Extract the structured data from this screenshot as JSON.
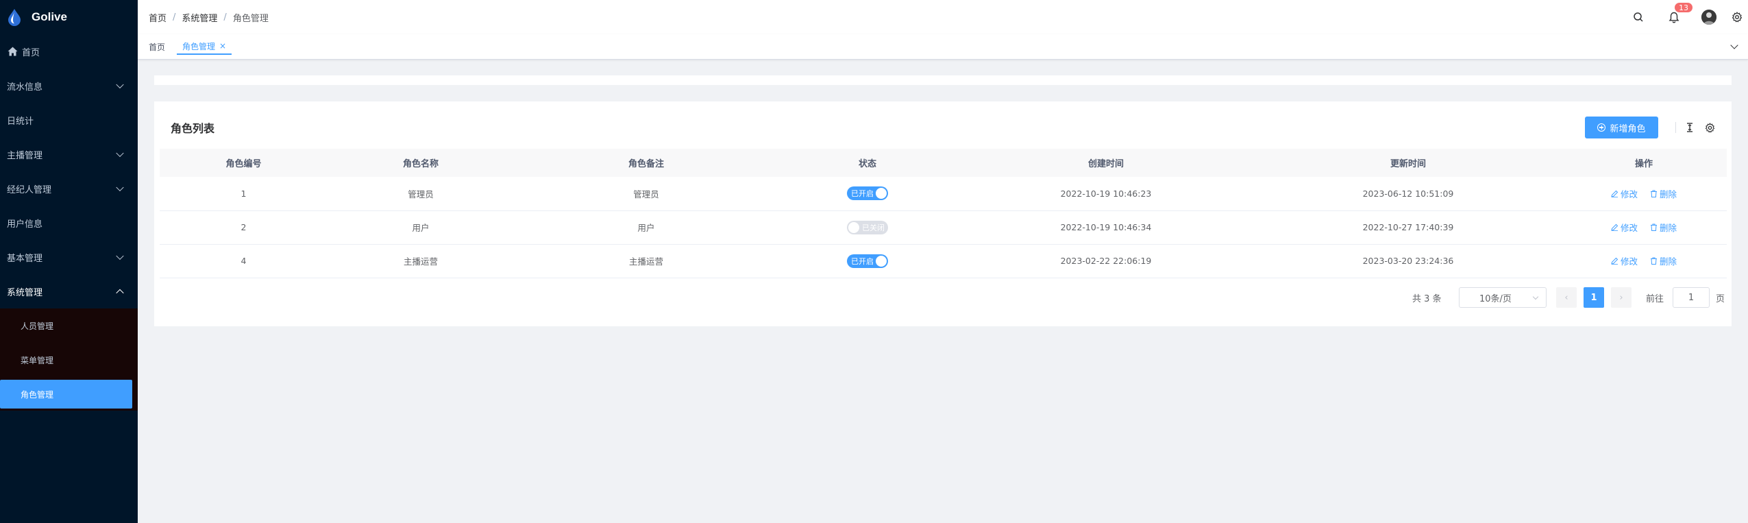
{
  "app": {
    "title": "Golive"
  },
  "sidebar": {
    "items": [
      {
        "label": "首页"
      },
      {
        "label": "流水信息"
      },
      {
        "label": "日统计"
      },
      {
        "label": "主播管理"
      },
      {
        "label": "经纪人管理"
      },
      {
        "label": "用户信息"
      },
      {
        "label": "基本管理"
      },
      {
        "label": "系统管理"
      }
    ],
    "sub_items": [
      {
        "label": "人员管理"
      },
      {
        "label": "菜单管理"
      },
      {
        "label": "角色管理"
      }
    ]
  },
  "header": {
    "breadcrumb": [
      "首页",
      "系统管理",
      "角色管理"
    ],
    "breadcrumb_separator": "/",
    "notification_count": "13"
  },
  "tags": {
    "home": "首页",
    "active": "角色管理",
    "close": "×"
  },
  "card": {
    "title": "角色列表",
    "add_button": "新增角色"
  },
  "table": {
    "columns": [
      "角色编号",
      "角色名称",
      "角色备注",
      "状态",
      "创建时间",
      "更新时间",
      "操作"
    ],
    "rows": [
      {
        "id": "1",
        "name": "管理员",
        "remark": "管理员",
        "status": "已开启",
        "status_on": true,
        "created": "2022-10-19 10:46:23",
        "updated": "2023-06-12 10:51:09"
      },
      {
        "id": "2",
        "name": "用户",
        "remark": "用户",
        "status": "已关闭",
        "status_on": false,
        "created": "2022-10-19 10:46:34",
        "updated": "2022-10-27 17:40:39"
      },
      {
        "id": "4",
        "name": "主播运营",
        "remark": "主播运营",
        "status": "已开启",
        "status_on": true,
        "created": "2023-02-22 22:06:19",
        "updated": "2023-03-20 23:24:36"
      }
    ],
    "edit_label": "修改",
    "delete_label": "删除"
  },
  "pagination": {
    "total": "共 3 条",
    "page_size": "10条/页",
    "prev": "‹",
    "next": "›",
    "current": "1",
    "goto_label": "前往",
    "goto_value": "1",
    "page_suffix": "页"
  },
  "colors": {
    "primary": "#409eff",
    "sidebar_bg": "#001529",
    "submenu_bg": "#170606",
    "badge": "#f56c6c",
    "switch_off": "#dcdfe6"
  },
  "icons": {
    "logo": "water-drop-icon",
    "home": "home-icon",
    "search": "search-icon",
    "bell": "bell-icon",
    "settings": "gear-icon",
    "column_height": "column-height-icon",
    "edit": "edit-icon",
    "delete": "trash-icon"
  }
}
